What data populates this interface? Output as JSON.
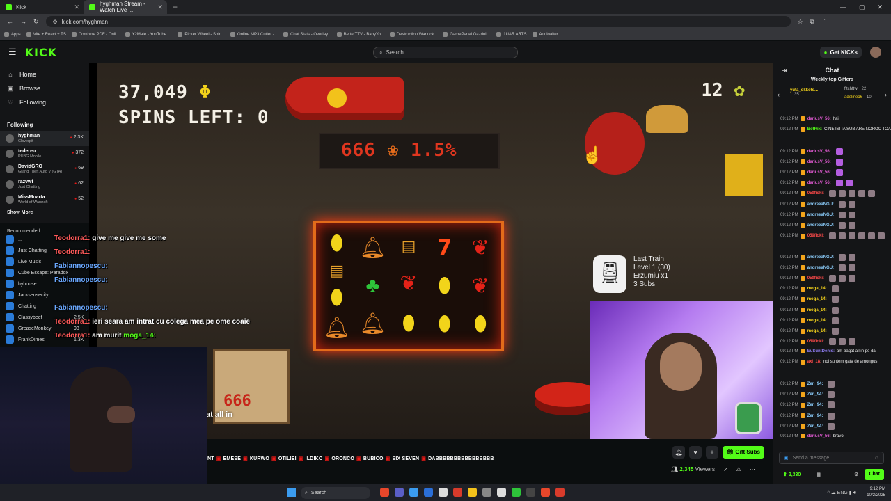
{
  "browser": {
    "tabs": [
      {
        "title": "Kick"
      },
      {
        "title": "hyghman Stream - Watch Live ..."
      }
    ],
    "url": "kick.com/hyghman",
    "bookmarks": [
      "Apps",
      "Vite + React + TS",
      "Combine PDF - Onli...",
      "Y2Mate - YouTube t...",
      "Picker Wheel - Spin...",
      "Online MP3 Cutter -...",
      "Chat Stats - Overlay...",
      "BetterTTV - BabyYo...",
      "Destruction Warlock...",
      "GamePanel Gazduir...",
      "1UAR ARTS",
      "Audioalter"
    ]
  },
  "header": {
    "logo": "KICK",
    "search_placeholder": "Search",
    "get_kicks": "Get KICKs"
  },
  "sidebar": {
    "nav": [
      {
        "label": "Home",
        "icon": "home-icon"
      },
      {
        "label": "Browse",
        "icon": "browse-icon"
      },
      {
        "label": "Following",
        "icon": "heart-icon"
      }
    ],
    "following_title": "Following",
    "following": [
      {
        "name": "hyghman",
        "game": "Cloverpit",
        "viewers": "2.3K"
      },
      {
        "name": "tedereu",
        "game": "PUBG Mobile",
        "viewers": "372"
      },
      {
        "name": "DavidGRO",
        "game": "Grand Theft Auto V (GTA)",
        "viewers": "69"
      },
      {
        "name": "razvwi",
        "game": "Just Chatting",
        "viewers": "62"
      },
      {
        "name": "MissMoarta",
        "game": "World of Warcraft",
        "viewers": "52"
      }
    ],
    "show_more": "Show More",
    "recommended": "Recommended",
    "ghost_items": [
      {
        "name": "...",
        "vc": ""
      },
      {
        "name": "Just Chatting",
        "vc": ""
      },
      {
        "name": "Live Music",
        "vc": ""
      },
      {
        "name": "Cube Escape: Paradox",
        "vc": ""
      },
      {
        "name": "hyhouse",
        "vc": ""
      },
      {
        "name": "Jacksensecity",
        "vc": ""
      },
      {
        "name": "Chatting",
        "vc": ""
      },
      {
        "name": "Classybeef",
        "vc": "2.5K"
      },
      {
        "name": "GreaseMonkey",
        "vc": "93"
      },
      {
        "name": "FrankDimes",
        "vc": "1.3K"
      }
    ]
  },
  "stream": {
    "coins": "37,049",
    "coin_symbol": "Φ",
    "spins": "SPINS LEFT: 0",
    "tickets": "12",
    "odds_number": "666",
    "odds_percent": "1.5%",
    "reels": [
      [
        "lemon",
        "bar",
        "lemon",
        "bell"
      ],
      [
        "bell",
        "clover",
        "bell"
      ],
      [
        "bar",
        "cherry",
        "lemon"
      ],
      [
        "seven",
        "lemon",
        "lemon"
      ],
      [
        "cherry",
        "cherry",
        "lemon"
      ]
    ],
    "box_label": "666",
    "train": {
      "title": "Last Train",
      "level": "Level 1 (30)",
      "gift": "Erzumiu x1",
      "subs": "3 Subs"
    },
    "caption": "at all in"
  },
  "overlay_chat": [
    {
      "user": "Teodorra1:",
      "msg": "give me give me some",
      "cls": "u"
    },
    {
      "user": "Teodorra1:",
      "msg": "",
      "cls": "u"
    },
    {
      "user": "Fabiannopescu:",
      "msg": "",
      "cls": "u2"
    },
    {
      "user": "Fabiannopescu:",
      "msg": "",
      "cls": "u2"
    },
    {
      "user": "Fabiannopescu:",
      "msg": "",
      "cls": "u2"
    },
    {
      "user": "Teodorra1:",
      "msg": "ieri seara am intrat cu colega mea pe ome coaie",
      "cls": "u"
    },
    {
      "user": "Teodorra1:",
      "msg": "am murit",
      "cls": "u",
      "extra": "moga_14:"
    }
  ],
  "below_player": {
    "marquee": [
      "NT",
      "EMESE",
      "KURWO",
      "OTILIEI",
      "ILDIKO",
      "ORONCO",
      "BUBICO",
      "SIX SEVEN",
      "DABBBBBBBBBBBBBBBB"
    ],
    "gift_subs": "Gift Subs",
    "viewers": "2,345",
    "viewers_label": "Viewers"
  },
  "chat": {
    "title": "Chat",
    "weekly_title": "Weekly top Gifters",
    "gifters": [
      {
        "name": "yuta_okkots...",
        "count": "35"
      },
      {
        "name": "fitchftw",
        "count": "22"
      },
      {
        "name": "adeline16",
        "count": "10"
      }
    ],
    "messages": [
      {
        "time": "09:12 PM",
        "user": "dariusV_56:",
        "text": "hai",
        "color": "#e45bd5",
        "emotes": 0
      },
      {
        "time": "09:12 PM",
        "user": "BotRix:",
        "text": "CINE ISI IA SUB ARE NOROC TOATA VIATA LUI",
        "color": "#53fc18",
        "emotes": 0
      },
      {
        "time": "",
        "user": "",
        "text": "",
        "color": "#fff",
        "emotes": 0
      },
      {
        "time": "09:12 PM",
        "user": "dariusV_56:",
        "text": "",
        "color": "#e45bd5",
        "emotes": 1
      },
      {
        "time": "09:12 PM",
        "user": "dariusV_56:",
        "text": "",
        "color": "#e45bd5",
        "emotes": 1
      },
      {
        "time": "09:12 PM",
        "user": "dariusV_56:",
        "text": "",
        "color": "#e45bd5",
        "emotes": 1
      },
      {
        "time": "09:12 PM",
        "user": "dariusV_56:",
        "text": "",
        "color": "#e45bd5",
        "emotes": 2
      },
      {
        "time": "09:12 PM",
        "user": "059fioki:",
        "text": "",
        "color": "#ff4a4a",
        "emotes": 5
      },
      {
        "time": "09:12 PM",
        "user": "andreeaNGU:",
        "text": "",
        "color": "#8ed0ff",
        "emotes": 2
      },
      {
        "time": "09:12 PM",
        "user": "andreeaNGU:",
        "text": "",
        "color": "#8ed0ff",
        "emotes": 2
      },
      {
        "time": "09:12 PM",
        "user": "andreeaNGU:",
        "text": "",
        "color": "#8ed0ff",
        "emotes": 2
      },
      {
        "time": "09:12 PM",
        "user": "059fioki:",
        "text": "",
        "color": "#ff4a4a",
        "emotes": 6
      },
      {
        "time": "",
        "user": "",
        "text": "",
        "color": "#fff",
        "emotes": 0
      },
      {
        "time": "09:12 PM",
        "user": "andreeaNGU:",
        "text": "",
        "color": "#8ed0ff",
        "emotes": 2
      },
      {
        "time": "09:12 PM",
        "user": "andreeaNGU:",
        "text": "",
        "color": "#8ed0ff",
        "emotes": 2
      },
      {
        "time": "09:12 PM",
        "user": "059fioki:",
        "text": "",
        "color": "#ff4a4a",
        "emotes": 3
      },
      {
        "time": "09:12 PM",
        "user": "moga_14:",
        "text": "",
        "color": "#f3d21b",
        "emotes": 1
      },
      {
        "time": "09:12 PM",
        "user": "moga_14:",
        "text": "",
        "color": "#f3d21b",
        "emotes": 1
      },
      {
        "time": "09:12 PM",
        "user": "moga_14:",
        "text": "",
        "color": "#f3d21b",
        "emotes": 1
      },
      {
        "time": "09:12 PM",
        "user": "moga_14:",
        "text": "",
        "color": "#f3d21b",
        "emotes": 1
      },
      {
        "time": "09:12 PM",
        "user": "moga_14:",
        "text": "",
        "color": "#f3d21b",
        "emotes": 1
      },
      {
        "time": "09:12 PM",
        "user": "059fioki:",
        "text": "",
        "color": "#ff4a4a",
        "emotes": 3
      },
      {
        "time": "09:12 PM",
        "user": "EuSuntDenis:",
        "text": "am băgat all in pe da",
        "color": "#8e7cf0",
        "emotes": 0
      },
      {
        "time": "09:12 PM",
        "user": "axl_18:",
        "text": "noi suntem gata de amongus",
        "color": "#ff4a4a",
        "emotes": 0
      },
      {
        "time": "",
        "user": "",
        "text": "",
        "color": "#fff",
        "emotes": 0
      },
      {
        "time": "09:12 PM",
        "user": "Zen_94:",
        "text": "",
        "color": "#8ed0ff",
        "emotes": 1
      },
      {
        "time": "09:12 PM",
        "user": "Zen_94:",
        "text": "",
        "color": "#8ed0ff",
        "emotes": 1
      },
      {
        "time": "09:12 PM",
        "user": "Zen_94:",
        "text": "",
        "color": "#8ed0ff",
        "emotes": 1
      },
      {
        "time": "09:12 PM",
        "user": "Zen_94:",
        "text": "",
        "color": "#8ed0ff",
        "emotes": 1
      },
      {
        "time": "09:12 PM",
        "user": "Zen_94:",
        "text": "",
        "color": "#8ed0ff",
        "emotes": 1
      },
      {
        "time": "09:12 PM",
        "user": "dariusV_56:",
        "text": "bravo",
        "color": "#e45bd5",
        "emotes": 0
      }
    ],
    "input_placeholder": "Send a message",
    "points": "2,330",
    "chat_button": "Chat"
  },
  "taskbar": {
    "search": "Search",
    "time": "9:12 PM",
    "date": "10/2/2025"
  }
}
